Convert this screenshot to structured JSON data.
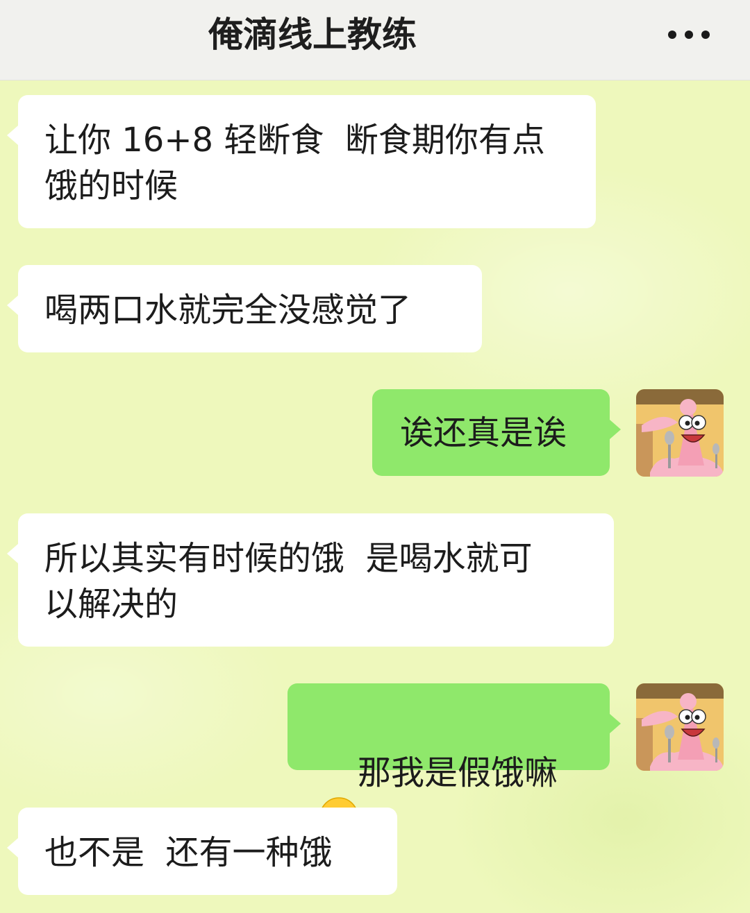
{
  "header": {
    "title": "俺滴线上教练",
    "more_icon": "more-dots-icon"
  },
  "messages": [
    {
      "side": "left",
      "text": "让你 16+8 轻断食  断食期你有点\n饿的时候"
    },
    {
      "side": "left",
      "text": "喝两口水就完全没感觉了"
    },
    {
      "side": "right",
      "text": "诶还真是诶",
      "avatar": "patrick-star-avatar"
    },
    {
      "side": "left",
      "text": "所以其实有时候的饿  是喝水就可\n以解决的"
    },
    {
      "side": "right",
      "text": "那我是假饿嘛",
      "emoji": "crying-face-icon",
      "avatar": "patrick-star-avatar"
    },
    {
      "side": "left",
      "text": "也不是  还有一种饿"
    }
  ],
  "colors": {
    "chat_background": "#eef8bc",
    "incoming_bubble": "#ffffff",
    "outgoing_bubble": "#8fe86b",
    "header_background": "#f1f1ee"
  }
}
